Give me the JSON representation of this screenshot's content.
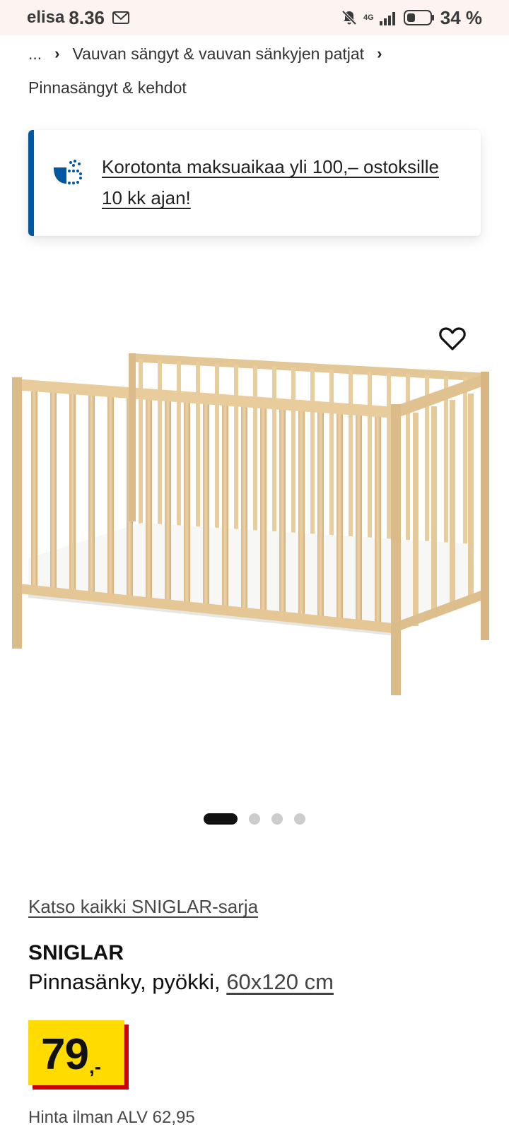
{
  "status_bar": {
    "carrier": "elisa",
    "time": "8.36",
    "network": "4G",
    "battery": "34 %"
  },
  "breadcrumb": {
    "ellipsis": "...",
    "parent": "Vauvan sängyt & vauvan sänkyjen patjat",
    "current": "Pinnasängyt & kehdot"
  },
  "promo": {
    "text": "Korotonta maksuaikaa yli 100,– ostoksille 10 kk ajan!",
    "accent_color": "#0058a3"
  },
  "gallery": {
    "image_count": 4,
    "active_index": 0
  },
  "product": {
    "series_link": "Katso kaikki SNIGLAR-sarja",
    "name": "SNIGLAR",
    "description": "Pinnasänky, pyökki,",
    "size": "60x120 cm",
    "price_integer": "79",
    "price_suffix": ",-",
    "price_ex_vat": "Hinta ilman ALV 62,95",
    "price_box_color": "#ffdb00",
    "price_shadow_color": "#cc0008"
  },
  "icons": {
    "mail": "mail-icon",
    "mute": "bell-off-icon",
    "signal": "signal-icon",
    "battery": "battery-icon",
    "promo": "payment-plan-icon",
    "favourite": "heart-icon"
  }
}
